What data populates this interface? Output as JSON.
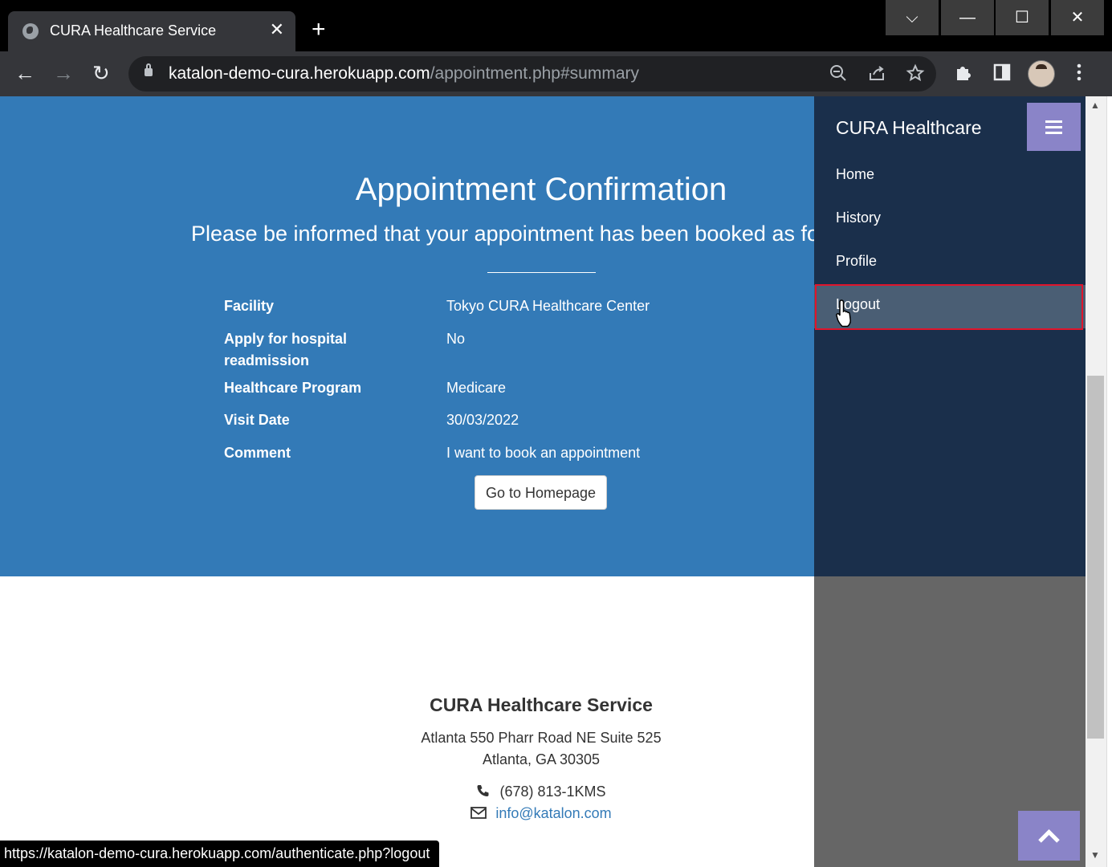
{
  "browser": {
    "tab_title": "CURA Healthcare Service",
    "close_glyph": "✕",
    "new_tab_glyph": "+",
    "window_controls": [
      "⌵",
      "—",
      "☐",
      "✕"
    ],
    "url_host": "katalon-demo-cura.herokuapp.com",
    "url_path": "/appointment.php#summary",
    "status_url": "https://katalon-demo-cura.herokuapp.com/authenticate.php?logout"
  },
  "page": {
    "title": "Appointment Confirmation",
    "subtitle": "Please be informed that your appointment has been booked as following:",
    "details": [
      {
        "label": "Facility",
        "value": "Tokyo CURA Healthcare Center"
      },
      {
        "label": "Apply for hospital readmission",
        "value": "No"
      },
      {
        "label": "Healthcare Program",
        "value": "Medicare"
      },
      {
        "label": "Visit Date",
        "value": "30/03/2022"
      },
      {
        "label": "Comment",
        "value": "I want to book an appointment"
      }
    ],
    "home_button": "Go to Homepage"
  },
  "footer": {
    "title": "CURA Healthcare Service",
    "address_line1": "Atlanta 550 Pharr Road NE Suite 525",
    "address_line2": "Atlanta, GA 30305",
    "phone": "(678) 813-1KMS",
    "email": "info@katalon.com"
  },
  "sidebar": {
    "brand": "CURA Healthcare",
    "items": [
      {
        "label": "Home"
      },
      {
        "label": "History"
      },
      {
        "label": "Profile"
      },
      {
        "label": "Logout"
      }
    ]
  },
  "colors": {
    "hero": "#337ab7",
    "sidebar": "#1a2f4b",
    "toggle": "#8a84c8",
    "highlight": "#e0152c"
  }
}
